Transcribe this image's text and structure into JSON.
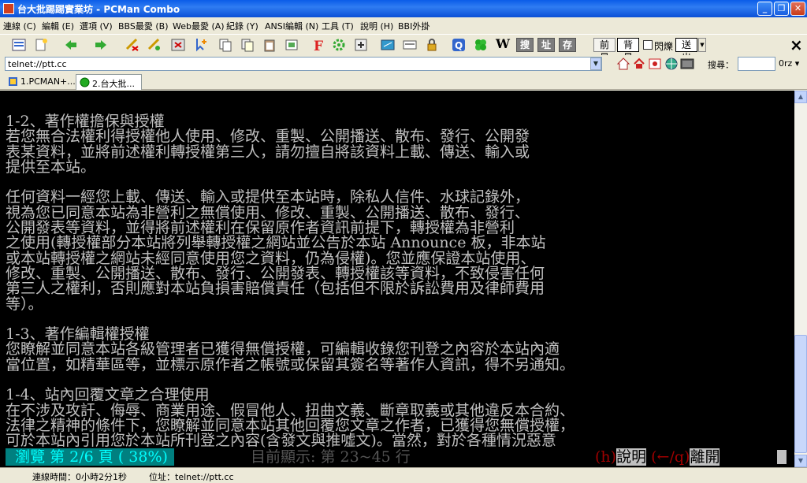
{
  "window": {
    "title": "台大批踢踢實業坊 - PCMan Combo",
    "controls": [
      "minimize",
      "maximize",
      "close"
    ]
  },
  "menu": [
    "連線 (C)",
    "編輯 (E)",
    "選項 (V)",
    "BBS最愛 (B)",
    "Web最愛 (A)",
    "紀錄 (Y)",
    "ANSI編輯 (N)",
    "工具 (T)",
    "說明 (H)",
    "BBI外掛"
  ],
  "toolbar": {
    "text_buttons": {
      "w": "W",
      "sou": "搜",
      "zhi": "址",
      "cun": "存",
      "qianjing": "前景",
      "beijing": "背景",
      "shansuo": "閃爍",
      "songchu": "送出"
    },
    "close_glyph": "×"
  },
  "address": {
    "value": "telnet://ptt.cc",
    "search_label": "搜尋：",
    "search_value": "",
    "engine": "0rz"
  },
  "tabs": [
    {
      "label": "1.PCMAN+...",
      "active": false
    },
    {
      "label": "2.台大批...",
      "active": true
    }
  ],
  "terminal": {
    "lines": [
      "1-2、著作權擔保與授權",
      "若您無合法權利得授權他人使用、修改、重製、公開播送、散布、發行、公開發",
      "表某資料，並將前述權利轉授權第三人，請勿擅自將該資料上載、傳送、輸入或",
      "提供至本站。",
      "",
      "任何資料一經您上載、傳送、輸入或提供至本站時，除私人信件、水球記錄外，",
      "視為您已同意本站為非營利之無償使用、修改、重製、公開播送、散布、發行、",
      "公開發表等資料，並得將前述權利在保留原作者資訊前提下，轉授權為非營利",
      "之使用(轉授權部分本站將列舉轉授權之網站並公告於本站 Announce 板，非本站",
      "或本站轉授權之網站未經同意使用您之資料，仍為侵權)。您並應保證本站使用、",
      "修改、重製、公開播送、散布、發行、公開發表、轉授權該等資料，不致侵害任何",
      "第三人之權利，否則應對本站負損害賠償責任（包括但不限於訴訟費用及律師費用",
      "等）。",
      "",
      "1-3、著作編輯權授權",
      "您瞭解並同意本站各級管理者已獲得無償授權，可編輯收錄您刊登之內容於本站內適",
      "當位置，如精華區等，並標示原作者之帳號或保留其簽名等著作人資訊，得不另通知。",
      "",
      "1-4、站內回覆文章之合理使用",
      "在不涉及攻訐、侮辱、商業用途、假冒他人、扭曲文義、斷章取義或其他違反本合約、",
      "法律之精神的條件下，您瞭解並同意本站其他回覆您文章之作者，已獲得您無償授權，",
      "可於本站內引用您於本站所刊登之內容(含發文與推噓文)。當然，對於各種情況惡意"
    ],
    "status": {
      "browse": "  瀏覽 第 2/6 頁 ( 38%)",
      "current": "目前顯示: 第 23~45 行",
      "help_h": "(h)",
      "help_h_label": "說明",
      "help_q": "(←/q)",
      "help_q_label": "離開"
    }
  },
  "statusbar": {
    "connection": "連線時間：0小時2分1秒",
    "address": "位址：telnet://ptt.cc"
  }
}
